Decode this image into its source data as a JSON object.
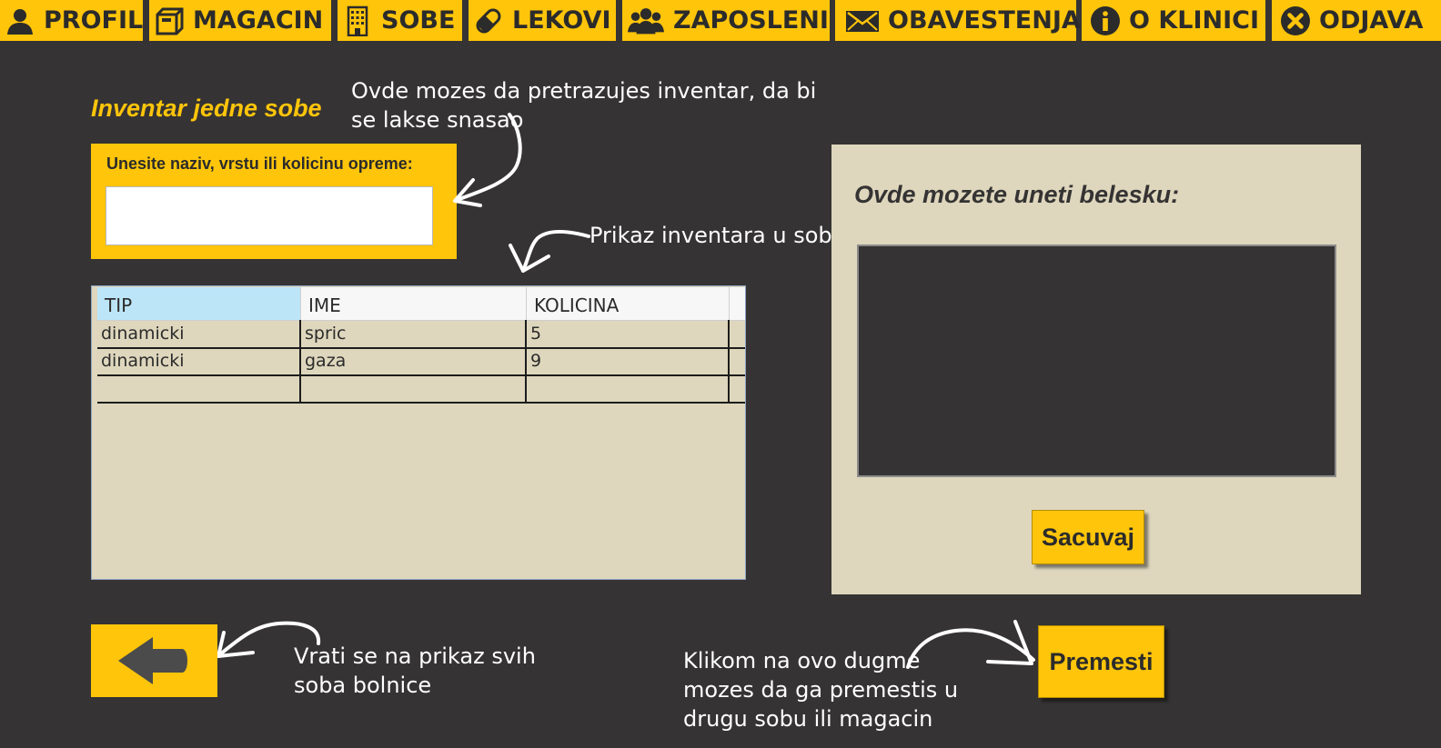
{
  "nav": {
    "items": [
      {
        "label": "PROFIL",
        "icon": "user-icon"
      },
      {
        "label": "MAGACIN",
        "icon": "box-icon"
      },
      {
        "label": "SOBE",
        "icon": "building-icon"
      },
      {
        "label": "LEKOVI",
        "icon": "pill-icon"
      },
      {
        "label": "ZAPOSLENI",
        "icon": "group-icon"
      },
      {
        "label": "OBAVESTENJA",
        "icon": "envelope-icon"
      },
      {
        "label": "O KLINICI",
        "icon": "info-icon"
      },
      {
        "label": "ODJAVA",
        "icon": "close-circle-icon"
      }
    ]
  },
  "page": {
    "title": "Inventar jedne sobe"
  },
  "search": {
    "label": "Unesite naziv, vrstu ili kolicinu opreme:",
    "value": "",
    "placeholder": ""
  },
  "annotations": {
    "search_hint_line1": "Ovde mozes da pretrazujes inventar, da bi",
    "search_hint_line2": "se lakse snasao",
    "table_hint": "Prikaz inventara u sobi",
    "back_hint_line1": "Vrati se na prikaz svih",
    "back_hint_line2": "soba bolnice",
    "move_hint_line1": "Klikom na ovo dugme",
    "move_hint_line2": "mozes da ga premestis u",
    "move_hint_line3": "drugu sobu ili magacin"
  },
  "table": {
    "columns": [
      "TIP",
      "IME",
      "KOLICINA"
    ],
    "rows": [
      [
        "dinamicki",
        "spric",
        "5"
      ],
      [
        "dinamicki",
        "gaza",
        "9"
      ],
      [
        "",
        "",
        ""
      ]
    ]
  },
  "note": {
    "title": "Ovde mozete uneti belesku:",
    "value": "",
    "save_label": "Sacuvaj"
  },
  "actions": {
    "move_label": "Premesti",
    "back_icon": "arrow-left-icon"
  },
  "colors": {
    "accent": "#ffc50a",
    "background": "#353333",
    "panel": "#ded7bd",
    "text_dark": "#2b2b2b",
    "header_selected": "#bde5f8"
  }
}
